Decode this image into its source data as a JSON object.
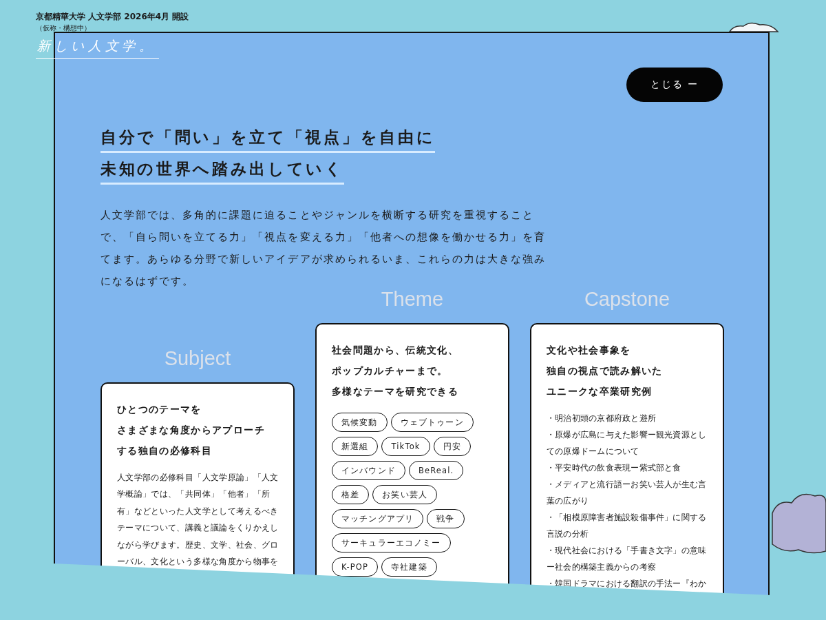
{
  "header": {
    "university": "京都精華大学 人文学部 2026年4月 開設",
    "note": "（仮称・構想中）",
    "logo": "新しい人文学。"
  },
  "close_button": {
    "label": "とじる ー"
  },
  "heading": [
    "自分で「問い」を立て「視点」を自由に",
    "未知の世界へ踏み出していく"
  ],
  "intro": "人文学部では、多角的に課題に迫ることやジャンルを横断する研究を重視することで、「自ら問いを立てる力」「視点を変える力」「他者への想像を働かせる力」を育てます。あらゆる分野で新しいアイデアが求められるいま、これらの力は大きな強みになるはずです。",
  "columns": [
    {
      "kind": "text",
      "title": "Subject",
      "heading": [
        "ひとつのテーマを",
        "さまざまな角度からアプローチ",
        "する独自の必修科目"
      ],
      "body": "人文学部の必修科目「人文学原論」「人文学概論」では、「共同体」「他者」「所有」などといった人文学として考えるべきテーマについて、講義と議論をくりかえしながら学びます。歴史、文学、社会、グローバル、文化という多様な角度から物事を"
    },
    {
      "kind": "tags",
      "title": "Theme",
      "heading": [
        "社会問題から、伝統文化、",
        "ポップカルチャーまで。",
        "多様なテーマを研究できる"
      ],
      "tags": [
        "気候変動",
        "ウェブトゥーン",
        "新選組",
        "TikTok",
        "円安",
        "インバウンド",
        "BeReal.",
        "格差",
        "お笑い芸人",
        "マッチングアプリ",
        "戦争",
        "サーキュラーエコノミー",
        "K-POP",
        "寺社建築"
      ]
    },
    {
      "kind": "list",
      "title": "Capstone",
      "heading": [
        "文化や社会事象を",
        "独自の視点で読み解いた",
        "ユニークな卒業研究例"
      ],
      "items": [
        "・明治初頭の京都府政と遊所",
        "・原爆が広島に与えた影響ー観光資源としての原爆ドームについて",
        "・平安時代の飲食表現ー紫式部と食",
        "・メディアと流行語ーお笑い芸人が生む言葉の広がり",
        "・「相模原障害者施設殺傷事件」に関する言説の分析",
        "・現代社会における「手書き文字」の意味ー社会的構築主義からの考察",
        "・韓国ドラマにおける翻訳の手法ー『わか"
      ]
    }
  ]
}
